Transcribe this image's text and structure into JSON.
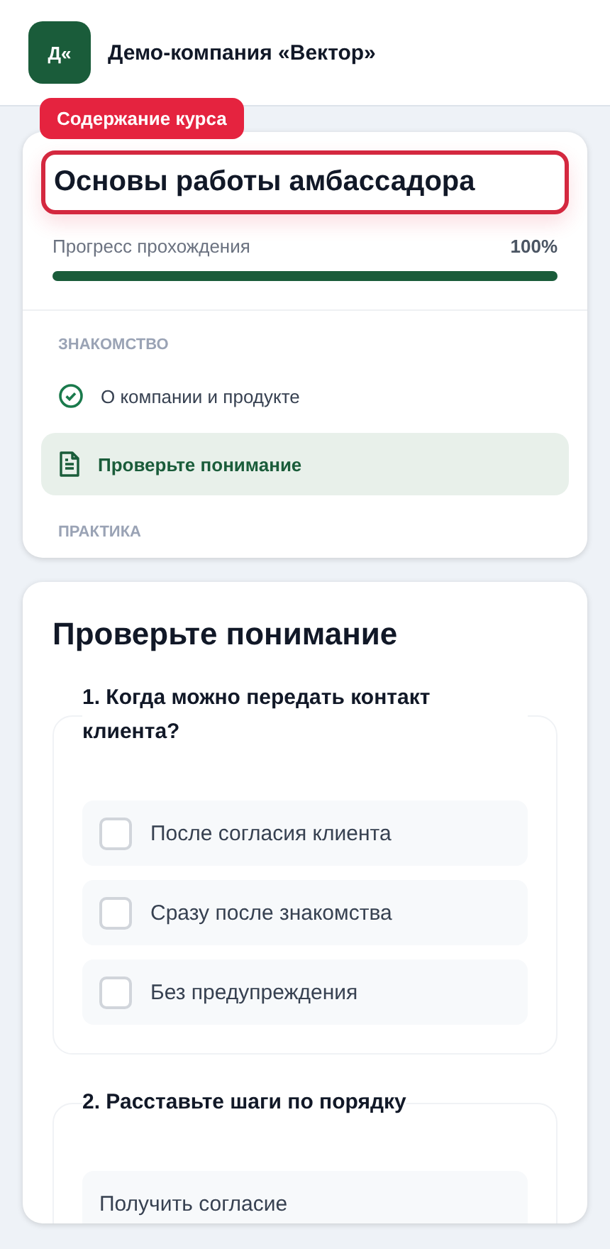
{
  "header": {
    "logo": "Д«",
    "company": "Демо-компания «Вектор»"
  },
  "course": {
    "tag": "Содержание курса",
    "title": "Основы работы амбассадора",
    "progress": {
      "label": "Прогресс прохождения",
      "reading": "100%",
      "level": 1
    },
    "sections": [
      {
        "title": "ЗНАКОМСТВО",
        "items": [
          {
            "label": "О компании и продукте",
            "kind": "done",
            "selected": false
          },
          {
            "label": "Проверьте понимание",
            "kind": "quiz",
            "selected": true
          }
        ]
      },
      {
        "title": "ПРАКТИКА"
      }
    ]
  },
  "quiz": {
    "title": "Проверьте понимание",
    "questions": [
      {
        "kind": "choice",
        "text": "1. Когда можно передать контакт клиента?",
        "options": [
          {
            "label": "После согласия клиента",
            "checked": false
          },
          {
            "label": "Сразу после знакомства",
            "checked": false
          },
          {
            "label": "Без предупреждения",
            "checked": false
          }
        ]
      },
      {
        "kind": "order",
        "text": "2. Расставьте шаги по порядку",
        "steps": [
          "Получить согласие"
        ]
      }
    ]
  }
}
